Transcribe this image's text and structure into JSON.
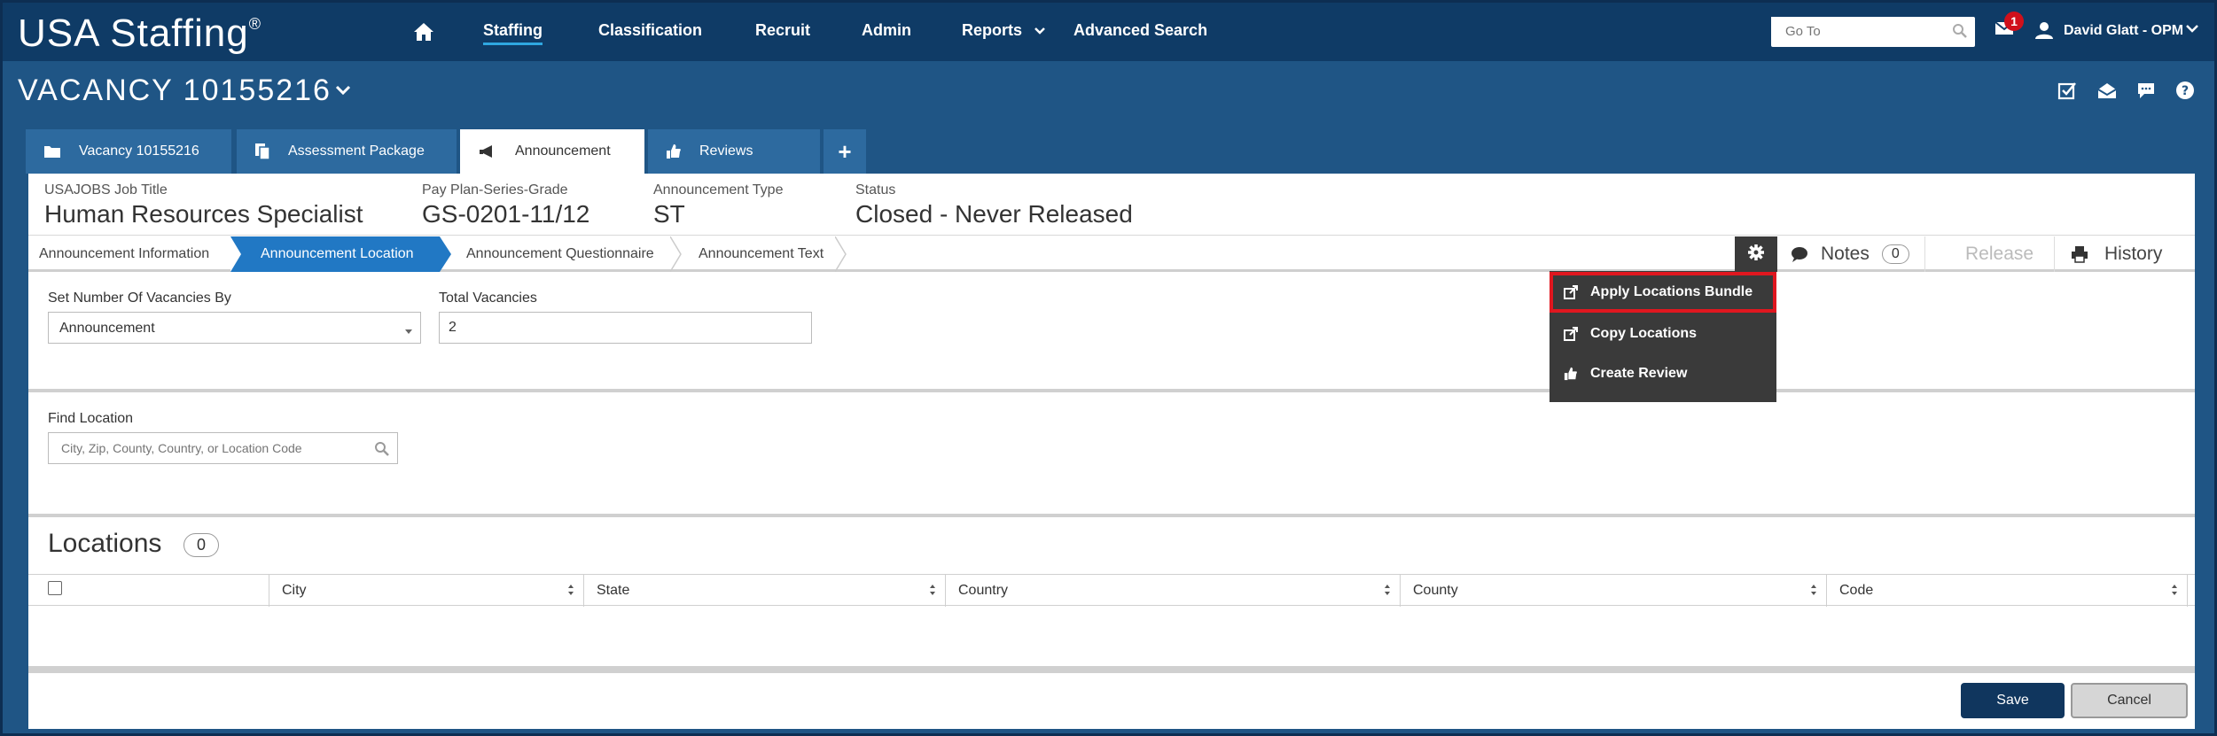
{
  "app": {
    "logo": "USA Staffing",
    "logo_mark": "®"
  },
  "nav": {
    "items": [
      {
        "label": "Staffing",
        "active": true
      },
      {
        "label": "Classification"
      },
      {
        "label": "Recruit"
      },
      {
        "label": "Admin"
      },
      {
        "label": "Reports"
      },
      {
        "label": "Advanced Search"
      }
    ],
    "goto_placeholder": "Go To",
    "mail_count": "1",
    "user_name": "David Glatt - OPM"
  },
  "vacancy": {
    "title": "VACANCY 10155216"
  },
  "tabs": [
    {
      "label": "Vacancy 10155216",
      "icon": "folder-icon"
    },
    {
      "label": "Assessment Package",
      "icon": "documents-icon"
    },
    {
      "label": "Announcement",
      "icon": "megaphone-icon",
      "active": true
    },
    {
      "label": "Reviews",
      "icon": "thumbs-up-icon"
    },
    {
      "label": "+",
      "icon": "plus-icon"
    }
  ],
  "summary": {
    "job_title_label": "USAJOBS Job Title",
    "job_title": "Human Resources Specialist",
    "grade_label": "Pay Plan-Series-Grade",
    "grade": "GS-0201-11/12",
    "type_label": "Announcement Type",
    "type": "ST",
    "status_label": "Status",
    "status": "Closed - Never Released"
  },
  "steps": [
    {
      "label": "Announcement Information"
    },
    {
      "label": "Announcement Location",
      "active": true
    },
    {
      "label": "Announcement Questionnaire"
    },
    {
      "label": "Announcement Text"
    }
  ],
  "toolbar": {
    "notes_label": "Notes",
    "notes_count": "0",
    "release_label": "Release",
    "history_label": "History"
  },
  "vacancies": {
    "set_by_label": "Set Number Of Vacancies By",
    "set_by_value": "Announcement",
    "total_label": "Total Vacancies",
    "total_value": "2"
  },
  "find_location": {
    "label": "Find Location",
    "placeholder": "City, Zip, County, Country, or Location Code"
  },
  "locations": {
    "title": "Locations",
    "count": "0",
    "columns": [
      "City",
      "State",
      "Country",
      "County",
      "Code"
    ]
  },
  "dropdown": {
    "items": [
      {
        "label": "Apply Locations Bundle",
        "highlighted": true
      },
      {
        "label": "Copy Locations"
      },
      {
        "label": "Create Review"
      }
    ]
  },
  "footer": {
    "save_label": "Save",
    "cancel_label": "Cancel"
  },
  "colors": {
    "nav_bg": "#0f3b66",
    "page_bg": "#1f5585",
    "accent": "#2178c4",
    "highlight": "#e0171f"
  }
}
